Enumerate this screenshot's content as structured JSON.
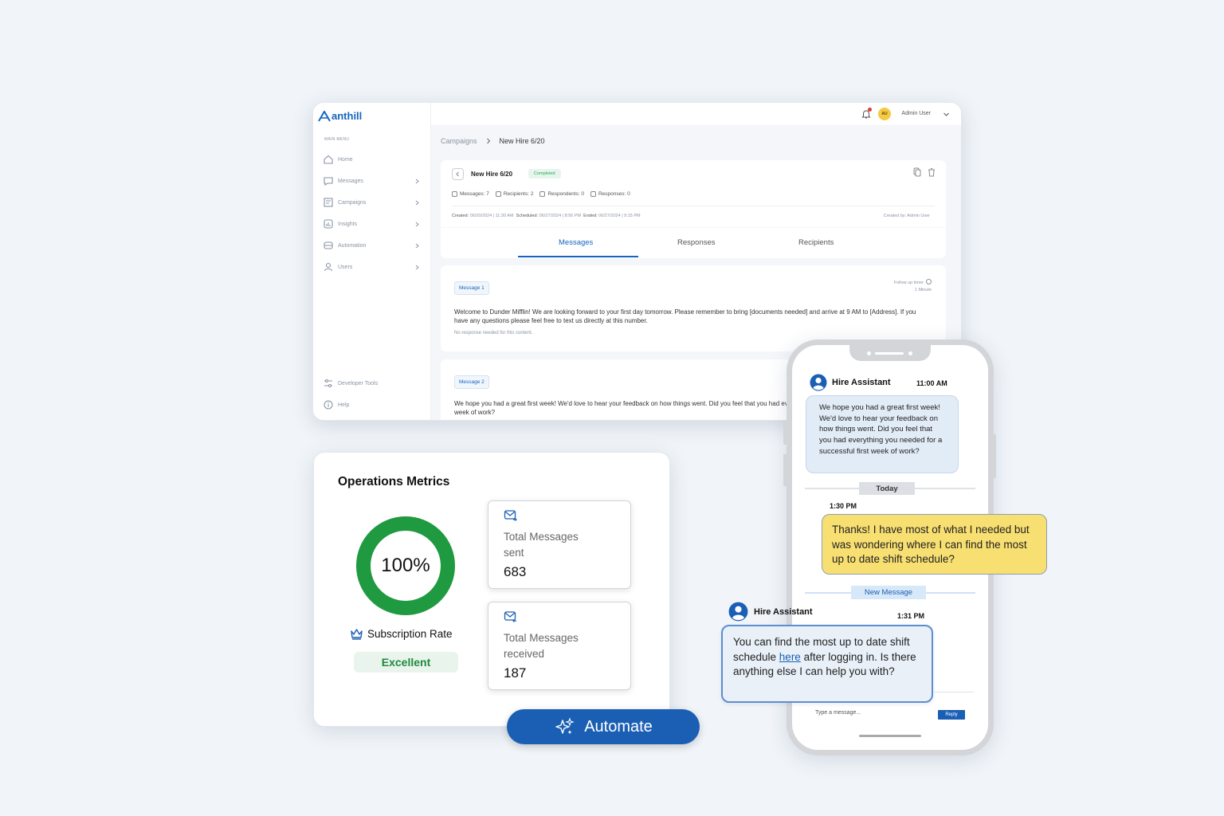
{
  "app": {
    "logo_text": "anthill"
  },
  "sidebar": {
    "caption": "MAIN MENU",
    "items": [
      {
        "label": "Home",
        "icon": "home-icon"
      },
      {
        "label": "Messages",
        "icon": "messages-icon"
      },
      {
        "label": "Campaigns",
        "icon": "campaigns-icon"
      },
      {
        "label": "Insights",
        "icon": "insights-icon"
      },
      {
        "label": "Automation",
        "icon": "automation-icon"
      },
      {
        "label": "Users",
        "icon": "users-icon"
      }
    ],
    "bottom_items": [
      {
        "label": "Developer Tools",
        "icon": "developer-tools-icon"
      },
      {
        "label": "Help",
        "icon": "help-icon"
      }
    ]
  },
  "topbar": {
    "avatar_initials": "AU",
    "user_name": "Admin User"
  },
  "breadcrumb": {
    "parent": "Campaigns",
    "current": "New Hire 6/20"
  },
  "campaign": {
    "title": "New Hire 6/20",
    "status": "Completed",
    "stats": {
      "messages": "Messages: 7",
      "recipients": "Recipients: 2",
      "respondents": "Respondents: 0",
      "responses": "Responses: 0"
    },
    "created_label": "Created:",
    "created": "06/20/2024 | 11:30 AM",
    "scheduled_label": "Scheduled:",
    "scheduled": "06/27/2024 | 8:56 PM",
    "ended_label": "Ended:",
    "ended": "06/27/2024 | 9:15 PM",
    "created_by": "Created by: Admin User"
  },
  "tabs": [
    {
      "label": "Messages",
      "active": true
    },
    {
      "label": "Responses",
      "active": false
    },
    {
      "label": "Recipients",
      "active": false
    }
  ],
  "messages": [
    {
      "tag": "Message 1",
      "follow_up_label": "Follow up timer",
      "follow_up_value": "1 Minute",
      "text": "Welcome to Dunder Mifflin! We are looking forward to your first day tomorrow. Please remember to bring [documents needed] and arrive at 9 AM to [Address]. If you have any questions please feel free to text us directly at this number.",
      "note": "No response needed for this content."
    },
    {
      "tag": "Message 2",
      "text": "We hope you had a great first week! We'd love to hear your feedback on how things went. Did you feel that you had everything you needed for a successful first week of work?"
    }
  ],
  "metrics": {
    "title": "Operations Metrics",
    "subscription_value": "100%",
    "subscription_fraction": 1.0,
    "subscription_label": "Subscription Rate",
    "subscription_rating": "Excellent",
    "cards": [
      {
        "label": "Total Messages sent",
        "value": "683",
        "icon": "mail-sent-icon"
      },
      {
        "label": "Total Messages received",
        "value": "187",
        "icon": "mail-received-icon"
      }
    ]
  },
  "automate": {
    "label": "Automate",
    "icon": "sparkles-icon"
  },
  "phone": {
    "sender": "Hire Assistant",
    "time1": "11:00 AM",
    "bubble1": "We hope you had a great first week! We'd love to hear your feedback on how things went. Did you feel that you had everything you needed for a successful first week of work?",
    "divider_today": "Today",
    "time2": "1:30 PM",
    "reply_user": "Thanks! I have most of what I needed but was wondering where I can find the most up to date shift schedule?",
    "divider_new": "New Message",
    "sender2": "Hire Assistant",
    "time3": "1:31 PM",
    "assistant_reply_before": "You can find the most up to date shift schedule ",
    "assistant_reply_link": "here",
    "assistant_reply_after": " after logging in. Is there anything else I can help you with?",
    "compose_placeholder": "Type a message...",
    "reply_button": "Reply"
  },
  "colors": {
    "brand": "#1565c0",
    "accent_button": "#1a5fb4",
    "ring_green": "#1f9a40",
    "status_green": "#2ea65a",
    "user_bubble": "#f8df71"
  }
}
